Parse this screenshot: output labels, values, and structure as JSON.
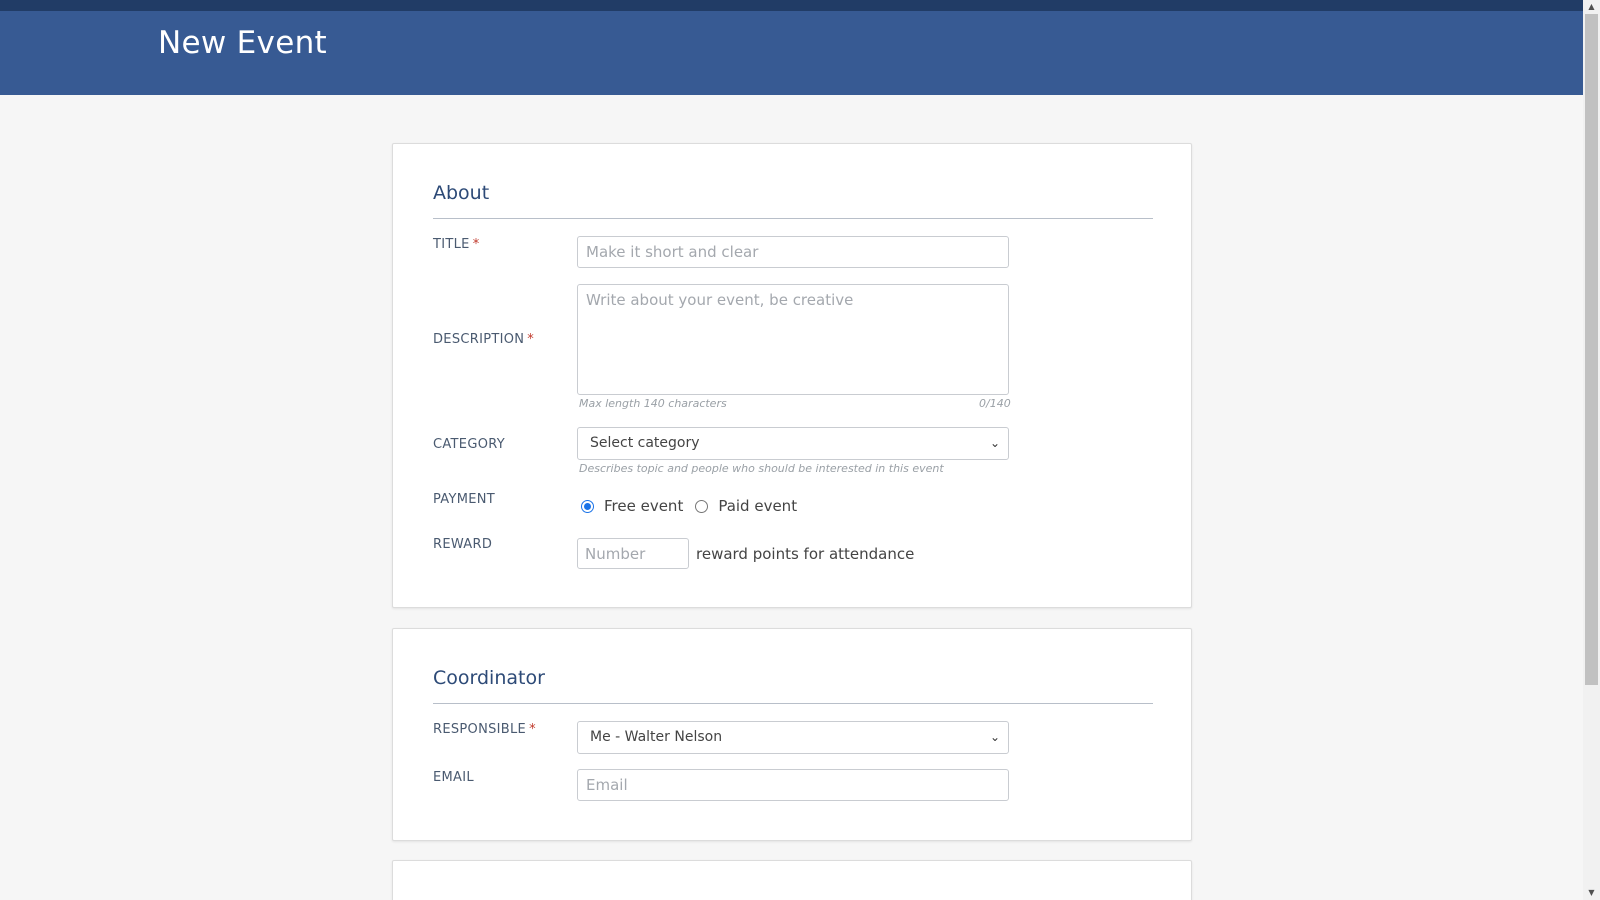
{
  "header": {
    "title": "New Event"
  },
  "about": {
    "title": "About",
    "title_field": {
      "label": "TITLE",
      "required_mark": "*",
      "placeholder": "Make it short and clear"
    },
    "description_field": {
      "label": "DESCRIPTION",
      "required_mark": "*",
      "placeholder": "Write about your event, be creative",
      "hint": "Max length 140 characters",
      "counter": "0/140"
    },
    "category_field": {
      "label": "CATEGORY",
      "selected": "Select category",
      "hint": "Describes topic and people who should be interested in this event"
    },
    "payment_field": {
      "label": "PAYMENT",
      "options": [
        {
          "label": "Free event",
          "checked": true
        },
        {
          "label": "Paid event",
          "checked": false
        }
      ]
    },
    "reward_field": {
      "label": "REWARD",
      "placeholder": "Number",
      "suffix": "reward points for attendance"
    }
  },
  "coordinator": {
    "title": "Coordinator",
    "responsible_field": {
      "label": "RESPONSIBLE",
      "required_mark": "*",
      "selected": "Me - Walter Nelson"
    },
    "email_field": {
      "label": "EMAIL",
      "placeholder": "Email"
    }
  },
  "icons": {
    "dropdown": "chevron-down-icon",
    "scroll_up": "arrow-up-icon",
    "scroll_down": "arrow-down-icon"
  },
  "colors": {
    "header": "#375a93",
    "header_strip": "#213c66",
    "section_title": "#2d4a77",
    "required": "#c0392b",
    "radio_accent": "#1a73e8"
  }
}
